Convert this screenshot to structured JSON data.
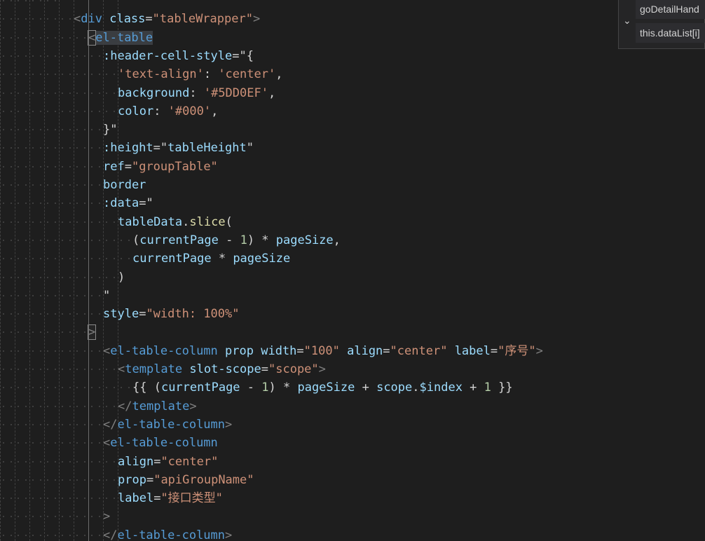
{
  "editor": {
    "lines": [
      {
        "indent": 8,
        "tokens": []
      },
      {
        "indent": 10,
        "tokens": [
          {
            "t": "<",
            "c": "punc"
          },
          {
            "t": "div",
            "c": "tag"
          },
          {
            "t": " ",
            "c": "txt"
          },
          {
            "t": "class",
            "c": "attr"
          },
          {
            "t": "=",
            "c": "txt"
          },
          {
            "t": "\"tableWrapper\"",
            "c": "str"
          },
          {
            "t": ">",
            "c": "punc"
          }
        ]
      },
      {
        "indent": 12,
        "tokens": [
          {
            "t": "<",
            "c": "punc",
            "hl": true
          },
          {
            "t": "el-table",
            "c": "tag",
            "sel": true
          }
        ]
      },
      {
        "indent": 14,
        "tokens": [
          {
            "t": ":header-cell-style",
            "c": "attr"
          },
          {
            "t": "=",
            "c": "txt"
          },
          {
            "t": "\"{",
            "c": "txt"
          }
        ]
      },
      {
        "indent": 16,
        "tokens": [
          {
            "t": "'text-align'",
            "c": "str"
          },
          {
            "t": ": ",
            "c": "txt"
          },
          {
            "t": "'center'",
            "c": "str"
          },
          {
            "t": ",",
            "c": "txt"
          }
        ]
      },
      {
        "indent": 16,
        "tokens": [
          {
            "t": "background",
            "c": "attr"
          },
          {
            "t": ": ",
            "c": "txt"
          },
          {
            "t": "'#5DD0EF'",
            "c": "str"
          },
          {
            "t": ",",
            "c": "txt"
          }
        ]
      },
      {
        "indent": 16,
        "tokens": [
          {
            "t": "color",
            "c": "attr"
          },
          {
            "t": ": ",
            "c": "txt"
          },
          {
            "t": "'#000'",
            "c": "str"
          },
          {
            "t": ",",
            "c": "txt"
          }
        ]
      },
      {
        "indent": 14,
        "tokens": [
          {
            "t": "}\"",
            "c": "txt"
          }
        ]
      },
      {
        "indent": 14,
        "tokens": [
          {
            "t": ":height",
            "c": "attr"
          },
          {
            "t": "=",
            "c": "txt"
          },
          {
            "t": "\"",
            "c": "txt"
          },
          {
            "t": "tableHeight",
            "c": "attr"
          },
          {
            "t": "\"",
            "c": "txt"
          }
        ]
      },
      {
        "indent": 14,
        "tokens": [
          {
            "t": "ref",
            "c": "attr"
          },
          {
            "t": "=",
            "c": "txt"
          },
          {
            "t": "\"groupTable\"",
            "c": "str"
          }
        ]
      },
      {
        "indent": 14,
        "tokens": [
          {
            "t": "border",
            "c": "attr"
          }
        ]
      },
      {
        "indent": 14,
        "tokens": [
          {
            "t": ":data",
            "c": "attr"
          },
          {
            "t": "=",
            "c": "txt"
          },
          {
            "t": "\"",
            "c": "txt"
          }
        ]
      },
      {
        "indent": 16,
        "tokens": [
          {
            "t": "tableData",
            "c": "attr"
          },
          {
            "t": ".",
            "c": "txt"
          },
          {
            "t": "slice",
            "c": "fn"
          },
          {
            "t": "(",
            "c": "txt"
          }
        ]
      },
      {
        "indent": 18,
        "tokens": [
          {
            "t": "(",
            "c": "txt"
          },
          {
            "t": "currentPage",
            "c": "attr"
          },
          {
            "t": " - ",
            "c": "txt"
          },
          {
            "t": "1",
            "c": "num"
          },
          {
            "t": ") * ",
            "c": "txt"
          },
          {
            "t": "pageSize",
            "c": "attr"
          },
          {
            "t": ",",
            "c": "txt"
          }
        ]
      },
      {
        "indent": 18,
        "tokens": [
          {
            "t": "currentPage",
            "c": "attr"
          },
          {
            "t": " * ",
            "c": "txt"
          },
          {
            "t": "pageSize",
            "c": "attr"
          }
        ]
      },
      {
        "indent": 16,
        "tokens": [
          {
            "t": ")",
            "c": "txt"
          }
        ]
      },
      {
        "indent": 14,
        "tokens": [
          {
            "t": "\"",
            "c": "txt"
          }
        ]
      },
      {
        "indent": 14,
        "tokens": [
          {
            "t": "style",
            "c": "attr"
          },
          {
            "t": "=",
            "c": "txt"
          },
          {
            "t": "\"width: 100%\"",
            "c": "str"
          }
        ]
      },
      {
        "indent": 12,
        "tokens": [
          {
            "t": ">",
            "c": "punc",
            "hl": true
          }
        ]
      },
      {
        "indent": 14,
        "tokens": [
          {
            "t": "<",
            "c": "punc"
          },
          {
            "t": "el-table-column",
            "c": "tag"
          },
          {
            "t": " ",
            "c": "txt"
          },
          {
            "t": "prop",
            "c": "attr"
          },
          {
            "t": " ",
            "c": "txt"
          },
          {
            "t": "width",
            "c": "attr"
          },
          {
            "t": "=",
            "c": "txt"
          },
          {
            "t": "\"100\"",
            "c": "str"
          },
          {
            "t": " ",
            "c": "txt"
          },
          {
            "t": "align",
            "c": "attr"
          },
          {
            "t": "=",
            "c": "txt"
          },
          {
            "t": "\"center\"",
            "c": "str"
          },
          {
            "t": " ",
            "c": "txt"
          },
          {
            "t": "label",
            "c": "attr"
          },
          {
            "t": "=",
            "c": "txt"
          },
          {
            "t": "\"序号\"",
            "c": "str"
          },
          {
            "t": ">",
            "c": "punc"
          }
        ]
      },
      {
        "indent": 16,
        "tokens": [
          {
            "t": "<",
            "c": "punc"
          },
          {
            "t": "template",
            "c": "tag"
          },
          {
            "t": " ",
            "c": "txt"
          },
          {
            "t": "slot-scope",
            "c": "attr"
          },
          {
            "t": "=",
            "c": "txt"
          },
          {
            "t": "\"scope\"",
            "c": "str"
          },
          {
            "t": ">",
            "c": "punc"
          }
        ]
      },
      {
        "indent": 18,
        "tokens": [
          {
            "t": "{{ (",
            "c": "txt"
          },
          {
            "t": "currentPage",
            "c": "attr"
          },
          {
            "t": " - ",
            "c": "txt"
          },
          {
            "t": "1",
            "c": "num"
          },
          {
            "t": ") * ",
            "c": "txt"
          },
          {
            "t": "pageSize",
            "c": "attr"
          },
          {
            "t": " + ",
            "c": "txt"
          },
          {
            "t": "scope",
            "c": "attr"
          },
          {
            "t": ".",
            "c": "txt"
          },
          {
            "t": "$index",
            "c": "attr"
          },
          {
            "t": " + ",
            "c": "txt"
          },
          {
            "t": "1",
            "c": "num"
          },
          {
            "t": " }}",
            "c": "txt"
          }
        ]
      },
      {
        "indent": 16,
        "tokens": [
          {
            "t": "</",
            "c": "punc"
          },
          {
            "t": "template",
            "c": "tag"
          },
          {
            "t": ">",
            "c": "punc"
          }
        ]
      },
      {
        "indent": 14,
        "tokens": [
          {
            "t": "</",
            "c": "punc"
          },
          {
            "t": "el-table-column",
            "c": "tag"
          },
          {
            "t": ">",
            "c": "punc"
          }
        ]
      },
      {
        "indent": 14,
        "tokens": [
          {
            "t": "<",
            "c": "punc"
          },
          {
            "t": "el-table-column",
            "c": "tag"
          }
        ]
      },
      {
        "indent": 16,
        "tokens": [
          {
            "t": "align",
            "c": "attr"
          },
          {
            "t": "=",
            "c": "txt"
          },
          {
            "t": "\"center\"",
            "c": "str"
          }
        ]
      },
      {
        "indent": 16,
        "tokens": [
          {
            "t": "prop",
            "c": "attr"
          },
          {
            "t": "=",
            "c": "txt"
          },
          {
            "t": "\"apiGroupName\"",
            "c": "str"
          }
        ]
      },
      {
        "indent": 16,
        "tokens": [
          {
            "t": "label",
            "c": "attr"
          },
          {
            "t": "=",
            "c": "txt"
          },
          {
            "t": "\"接口类型\"",
            "c": "str"
          }
        ]
      },
      {
        "indent": 14,
        "tokens": [
          {
            "t": ">",
            "c": "punc"
          }
        ]
      },
      {
        "indent": 14,
        "tokens": [
          {
            "t": "</",
            "c": "punc"
          },
          {
            "t": "el-table-column",
            "c": "tag"
          },
          {
            "t": ">",
            "c": "punc"
          }
        ]
      }
    ]
  },
  "suggest": {
    "items": [
      "goDetailHand",
      "this.dataList[i]"
    ]
  }
}
